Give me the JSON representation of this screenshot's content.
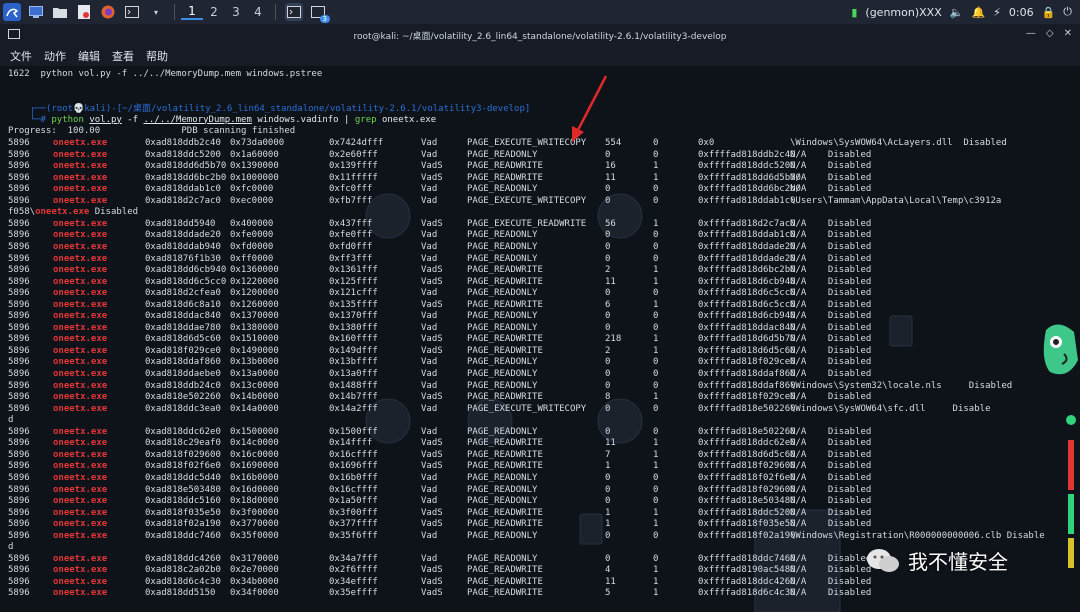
{
  "taskbar": {
    "workspaces": [
      "1",
      "2",
      "3",
      "4"
    ],
    "active_workspace": "1",
    "badge_count": "3",
    "network_label": "(genmon)XXX",
    "clock": "0:06"
  },
  "window": {
    "title": "root@kali: ~/桌面/volatility_2.6_lin64_standalone/volatility-2.6.1/volatility3-develop"
  },
  "menu": [
    "文件",
    "动作",
    "编辑",
    "查看",
    "帮助"
  ],
  "terminal": {
    "history_line": "1622  python vol.py -f ../../MemoryDump.mem windows.pstree",
    "prompt_top": "┌──(root💀kali)-[~/桌面/volatility_2.6_lin64_standalone/volatility-2.6.1/volatility3-develop]",
    "prompt_bottom_prefix": "└─# ",
    "cmd_python": "python",
    "cmd_script": "vol.py",
    "cmd_flag": "-f",
    "cmd_file": "../../MemoryDump.mem",
    "cmd_plugin": "windows.vadinfo",
    "cmd_pipe": "|",
    "cmd_grep": "grep",
    "cmd_grep_arg": "oneetx.exe",
    "progress_line": "Progress:  100.00               PDB scanning finished",
    "rows": [
      [
        "5896",
        "oneetx.exe",
        "0xad818ddb2c40",
        "0x73da0000",
        "0x73da0000",
        "0x7424dfff",
        "Vad",
        "PAGE_EXECUTE_WRITECOPY",
        "554",
        "0",
        "0x0",
        "\\Windows\\SysWOW64\\AcLayers.dll  Disabled"
      ],
      [
        "5896",
        "oneetx.exe",
        "0xad818ddc5200",
        "0x1a60000",
        "0x1a60000",
        "0x2e60fff",
        "Vad",
        "PAGE_READONLY",
        "0",
        "0",
        "0xffffad818ddb2c40",
        "N/A    Disabled"
      ],
      [
        "5896",
        "oneetx.exe",
        "0xad818dd6d5b70",
        "0x1390000",
        "0x1390000",
        "0x139ffff",
        "VadS",
        "PAGE_READWRITE",
        "16",
        "1",
        "0xffffad818ddc5200",
        "N/A    Disabled"
      ],
      [
        "5896",
        "oneetx.exe",
        "0xad818dd6bc2b0",
        "0x1000000",
        "0x1000000",
        "0x11fffff",
        "VadS",
        "PAGE_READWRITE",
        "11",
        "1",
        "0xffffad818dd6d5b70",
        "N/A    Disabled"
      ],
      [
        "5896",
        "oneetx.exe",
        "0xad818ddab1c0",
        "0xfc0000",
        "0xfc0000",
        "0xfc0fff",
        "Vad",
        "PAGE_READONLY",
        "0",
        "0",
        "0xffffad818dd6bc2b0",
        "N/A    Disabled"
      ],
      [
        "5896",
        "oneetx.exe",
        "0xad818d2c7ac0",
        "0xec0000",
        "0xec0000",
        "0xfb7fff",
        "Vad",
        "PAGE_EXECUTE_WRITECOPY",
        "0",
        "0",
        "0xffffad818ddab1c0",
        "\\Users\\Tammam\\AppData\\Local\\Temp\\c3912a"
      ]
    ],
    "wrap_line": "f058\\oneetx.exe Disabled",
    "rows2": [
      [
        "5896",
        "oneetx.exe",
        "0xad818dd5940",
        "0x400000",
        "0x400000",
        "0x437fff",
        "VadS",
        "PAGE_EXECUTE_READWRITE",
        "56",
        "1",
        "0xffffad818d2c7ac0",
        "N/A    Disabled"
      ],
      [
        "5896",
        "oneetx.exe",
        "0xad818ddade20",
        "0xfe0000",
        "0xfe0000",
        "0xfe0fff",
        "Vad",
        "PAGE_READONLY",
        "0",
        "0",
        "0xffffad818ddab1c0",
        "N/A    Disabled"
      ],
      [
        "5896",
        "oneetx.exe",
        "0xad818ddab940",
        "0xfd0000",
        "0xfd0000",
        "0xfd0fff",
        "Vad",
        "PAGE_READONLY",
        "0",
        "0",
        "0xffffad818ddade20",
        "N/A    Disabled"
      ],
      [
        "5896",
        "oneetx.exe",
        "0xad81876f1b30",
        "0xff0000",
        "0xff0000",
        "0xff3fff",
        "Vad",
        "PAGE_READONLY",
        "0",
        "0",
        "0xffffad818ddade20",
        "N/A    Disabled"
      ],
      [
        "5896",
        "oneetx.exe",
        "0xad818dd6cb940",
        "0x1360000",
        "0x1360000",
        "0x1361fff",
        "VadS",
        "PAGE_READWRITE",
        "2",
        "1",
        "0xffffad818d6bc2b0",
        "N/A    Disabled"
      ],
      [
        "5896",
        "oneetx.exe",
        "0xad818dd6c5cc0",
        "0x1220000",
        "0x1220000",
        "0x125ffff",
        "VadS",
        "PAGE_READWRITE",
        "11",
        "1",
        "0xffffad818d6cb940",
        "N/A    Disabled"
      ],
      [
        "5896",
        "oneetx.exe",
        "0xad818d2cfea0",
        "0x1200000",
        "0x1200000",
        "0x121cfff",
        "Vad",
        "PAGE_READONLY",
        "0",
        "0",
        "0xffffad818d6c5cc0",
        "N/A    Disabled"
      ],
      [
        "5896",
        "oneetx.exe",
        "0xad818d6c8a10",
        "0x1260000",
        "0x1260000",
        "0x135ffff",
        "VadS",
        "PAGE_READWRITE",
        "6",
        "1",
        "0xffffad818d6c5cc0",
        "N/A    Disabled"
      ],
      [
        "5896",
        "oneetx.exe",
        "0xad818ddac840",
        "0x1370000",
        "0x1370000",
        "0x1370fff",
        "Vad",
        "PAGE_READONLY",
        "0",
        "0",
        "0xffffad818d6cb940",
        "N/A    Disabled"
      ],
      [
        "5896",
        "oneetx.exe",
        "0xad818ddae780",
        "0x1380000",
        "0x1380000",
        "0x1380fff",
        "Vad",
        "PAGE_READONLY",
        "0",
        "0",
        "0xffffad818ddac840",
        "N/A    Disabled"
      ],
      [
        "5896",
        "oneetx.exe",
        "0xad818d6d5c60",
        "0x1510000",
        "0x1510000",
        "0x160ffff",
        "VadS",
        "PAGE_READWRITE",
        "218",
        "1",
        "0xffffad818d6d5b70",
        "N/A    Disabled"
      ],
      [
        "5896",
        "oneetx.exe",
        "0xad818f029ce0",
        "0x1490000",
        "0x1490000",
        "0x149dfff",
        "VadS",
        "PAGE_READWRITE",
        "2",
        "1",
        "0xffffad818d6d5c60",
        "N/A    Disabled"
      ],
      [
        "5896",
        "oneetx.exe",
        "0xad818ddaf860",
        "0x13b0000",
        "0x13b0000",
        "0x13bffff",
        "Vad",
        "PAGE_READONLY",
        "0",
        "0",
        "0xffffad818f029ce0",
        "N/A    Disabled"
      ],
      [
        "5896",
        "oneetx.exe",
        "0xad818ddaebe0",
        "0x13a0000",
        "0x13a0000",
        "0x13a0fff",
        "Vad",
        "PAGE_READONLY",
        "0",
        "0",
        "0xffffad818ddaf860",
        "N/A    Disabled"
      ],
      [
        "5896",
        "oneetx.exe",
        "0xad818ddb24c0",
        "0x13c0000",
        "0x13c0000",
        "0x1488fff",
        "Vad",
        "PAGE_READONLY",
        "0",
        "0",
        "0xffffad818ddaf860",
        "\\Windows\\System32\\locale.nls     Disabled"
      ],
      [
        "5896",
        "oneetx.exe",
        "0xad818e502260",
        "0x14b0000",
        "0x14b0000",
        "0x14b7fff",
        "VadS",
        "PAGE_READWRITE",
        "8",
        "1",
        "0xffffad818f029ce0",
        "N/A    Disabled"
      ],
      [
        "5896",
        "oneetx.exe",
        "0xad818ddc3ea0",
        "0x14a0000",
        "0x14a0000",
        "0x14a2fff",
        "Vad",
        "PAGE_EXECUTE_WRITECOPY",
        "0",
        "0",
        "0xffffad818e502260",
        "\\Windows\\SysWOW64\\sfc.dll     Disable"
      ]
    ],
    "wrap_line2": "d",
    "rows3": [
      [
        "5896",
        "oneetx.exe",
        "0xad818ddc62e0",
        "0x1500000",
        "0x1500000",
        "0x1500fff",
        "Vad",
        "PAGE_READONLY",
        "0",
        "0",
        "0xffffad818e502260",
        "N/A    Disabled"
      ],
      [
        "5896",
        "oneetx.exe",
        "0xad818c29eaf0",
        "0x14c0000",
        "0x14c0000",
        "0x14ffff",
        "VadS",
        "PAGE_READWRITE",
        "11",
        "1",
        "0xffffad818ddc62e0",
        "N/A    Disabled"
      ],
      [
        "5896",
        "oneetx.exe",
        "0xad818f029600",
        "0x16c0000",
        "0x16c0000",
        "0x16cffff",
        "VadS",
        "PAGE_READWRITE",
        "7",
        "1",
        "0xffffad818d6d5c60",
        "N/A    Disabled"
      ],
      [
        "5896",
        "oneetx.exe",
        "0xad818f02f6e0",
        "0x1690000",
        "0x1690000",
        "0x1696fff",
        "VadS",
        "PAGE_READWRITE",
        "1",
        "1",
        "0xffffad818f029600",
        "N/A    Disabled"
      ],
      [
        "5896",
        "oneetx.exe",
        "0xad818ddc5d40",
        "0x16b0000",
        "0x16b0000",
        "0x16b0fff",
        "Vad",
        "PAGE_READONLY",
        "0",
        "0",
        "0xffffad818f02f6e0",
        "N/A    Disabled"
      ],
      [
        "5896",
        "oneetx.exe",
        "0xad818e503480",
        "0x16d0000",
        "0x16d0000",
        "0x16cffff",
        "Vad",
        "PAGE_READONLY",
        "0",
        "0",
        "0xffffad818f029600",
        "N/A    Disabled"
      ],
      [
        "5896",
        "oneetx.exe",
        "0xad818ddc5160",
        "0x18d0000",
        "0x18d0000",
        "0x1a50fff",
        "Vad",
        "PAGE_READONLY",
        "0",
        "0",
        "0xffffad818e503480",
        "N/A    Disabled"
      ],
      [
        "5896",
        "oneetx.exe",
        "0xad818f035e50",
        "0x3f00000",
        "0x3f00000",
        "0x3f00fff",
        "VadS",
        "PAGE_READWRITE",
        "1",
        "1",
        "0xffffad818ddc5200",
        "N/A    Disabled"
      ],
      [
        "5896",
        "oneetx.exe",
        "0xad818f02a190",
        "0x3770000",
        "0x3770000",
        "0x377ffff",
        "VadS",
        "PAGE_READWRITE",
        "1",
        "1",
        "0xffffad818f035e50",
        "N/A    Disabled"
      ],
      [
        "5896",
        "oneetx.exe",
        "0xad818ddc7460",
        "0x35f0000",
        "0x35f0000",
        "0x35f6fff",
        "Vad",
        "PAGE_READONLY",
        "0",
        "0",
        "0xffffad818f02a190",
        "\\Windows\\Registration\\R000000000006.clb Disable"
      ]
    ],
    "wrap_line3": "d",
    "rows4": [
      [
        "5896",
        "oneetx.exe",
        "0xad818ddc4260",
        "0x3170000",
        "0x3170000",
        "0x34a7fff",
        "Vad",
        "PAGE_READONLY",
        "0",
        "0",
        "0xffffad818ddc7460",
        "N/A    Disabled"
      ],
      [
        "5896",
        "oneetx.exe",
        "0xad818c2a02b0",
        "0x2e70000",
        "0x2e70000",
        "0x2f6ffff",
        "VadS",
        "PAGE_READWRITE",
        "4",
        "1",
        "0xffffad8190ac5480",
        "N/A    Disabled"
      ],
      [
        "5896",
        "oneetx.exe",
        "0xad818d6c4c30",
        "0x34b0000",
        "0x34b0000",
        "0x34effff",
        "VadS",
        "PAGE_READWRITE",
        "11",
        "1",
        "0xffffad818ddc4260",
        "N/A    Disabled"
      ],
      [
        "5896",
        "oneetx.exe",
        "0xad818dd5150",
        "0x34f0000",
        "0x34f0000",
        "0x35effff",
        "VadS",
        "PAGE_READWRITE",
        "5",
        "1",
        "0xffffad818d6c4c30",
        "N/A    Disabled"
      ]
    ]
  },
  "watermark": {
    "text": "我不懂安全"
  }
}
